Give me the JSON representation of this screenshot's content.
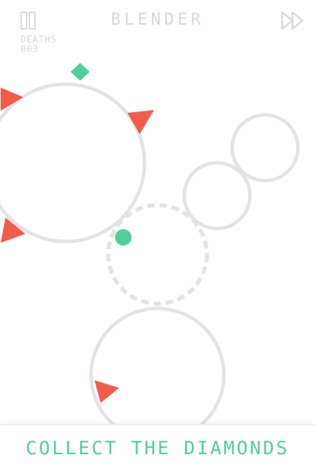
{
  "header": {
    "title": "BLENDER",
    "deaths_label": "DEATHS",
    "deaths_value": "003",
    "pause_icon": "pause-icon",
    "fast_forward_icon": "fast-forward-icon"
  },
  "footer": {
    "instruction": "COLLECT THE DIAMONDS"
  },
  "colors": {
    "ring": "#e3e3e3",
    "hazard": "#f25c4a",
    "diamond": "#4fcf9b",
    "player": "#4fcf9b",
    "hud": "#d8d8d8",
    "accent_text": "#4fcf9b"
  },
  "game": {
    "collectibles_visible": 1,
    "hazards_visible": 4,
    "rings_visible": 5
  }
}
